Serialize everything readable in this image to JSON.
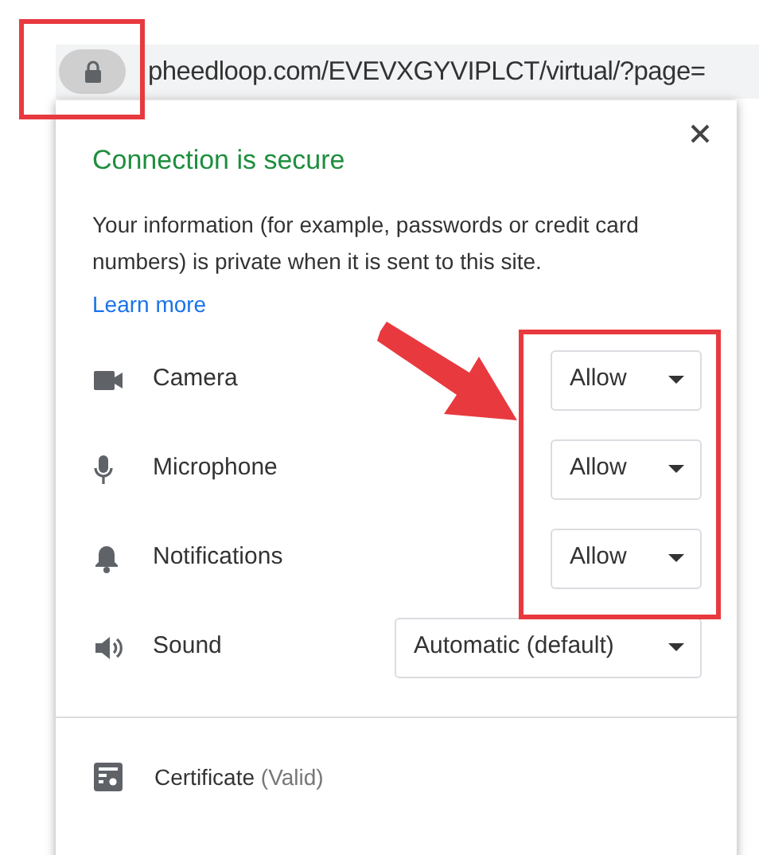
{
  "address_bar": {
    "url": "pheedloop.com/EVEVXGYVIPLCT/virtual/?page="
  },
  "popup": {
    "title": "Connection is secure",
    "message": "Your information (for example, passwords or credit card numbers) is private when it is sent to this site.",
    "link": "Learn more",
    "permissions": [
      {
        "kind": "camera",
        "label": "Camera",
        "value": "Allow"
      },
      {
        "kind": "microphone",
        "label": "Microphone",
        "value": "Allow"
      },
      {
        "kind": "notifications",
        "label": "Notifications",
        "value": "Allow"
      },
      {
        "kind": "sound",
        "label": "Sound",
        "value": "Automatic (default)"
      }
    ],
    "certificate": {
      "label": "Certificate",
      "status": "(Valid)"
    }
  }
}
